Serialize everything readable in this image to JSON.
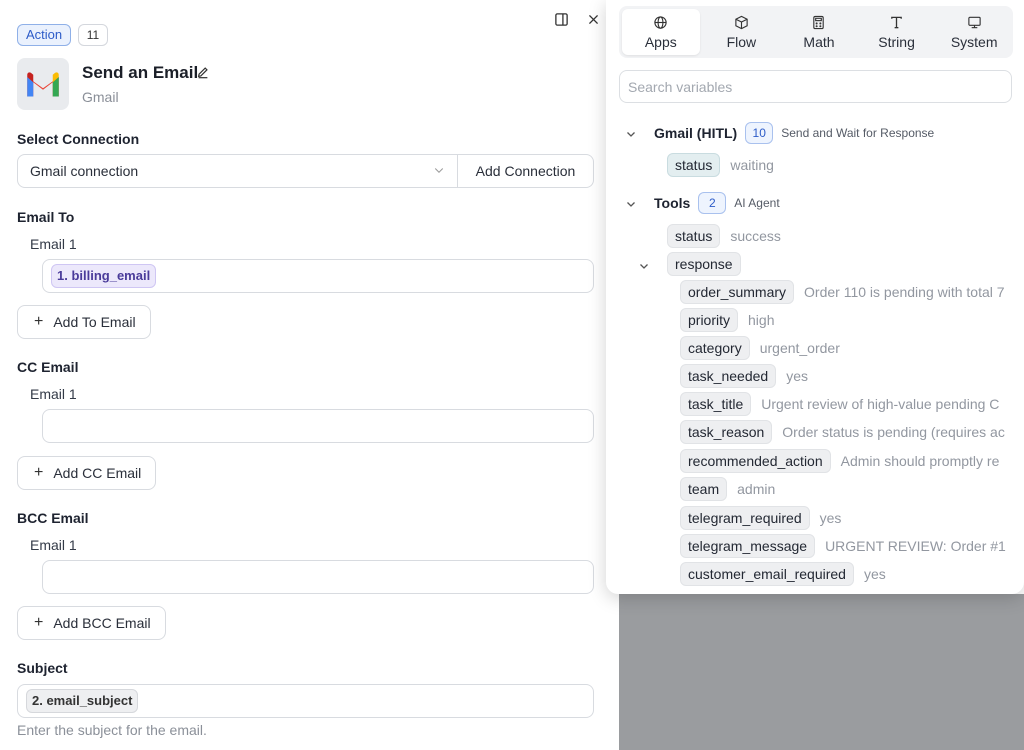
{
  "header": {
    "badge": "Action",
    "count": "11",
    "title": "Send an Email",
    "subtitle": "Gmail"
  },
  "connection": {
    "label": "Select Connection",
    "value": "Gmail connection",
    "add_label": "Add Connection"
  },
  "email_to": {
    "label": "Email To",
    "sub": "Email 1",
    "chip": "1. billing_email",
    "add_label": "Add To Email"
  },
  "cc": {
    "label": "CC Email",
    "sub": "Email 1",
    "add_label": "Add CC Email"
  },
  "bcc": {
    "label": "BCC Email",
    "sub": "Email 1",
    "add_label": "Add BCC Email"
  },
  "subject": {
    "label": "Subject",
    "chip": "2. email_subject",
    "hint": "Enter the subject for the email."
  },
  "popover": {
    "tabs": [
      {
        "label": "Apps",
        "icon": "globe-icon"
      },
      {
        "label": "Flow",
        "icon": "cube-icon"
      },
      {
        "label": "Math",
        "icon": "calculator-icon"
      },
      {
        "label": "String",
        "icon": "text-icon"
      },
      {
        "label": "System",
        "icon": "monitor-icon"
      }
    ],
    "search_placeholder": "Search variables",
    "groups": [
      {
        "name": "Gmail (HITL)",
        "count": "10",
        "desc": "Send and Wait for Response",
        "items": [
          {
            "key": "status",
            "value": "waiting"
          }
        ]
      },
      {
        "name": "Tools",
        "count": "2",
        "desc": "AI Agent",
        "items": [
          {
            "key": "status",
            "value": "success"
          },
          {
            "key": "response",
            "value": ""
          }
        ],
        "response_items": [
          {
            "key": "order_summary",
            "value": "Order 110 is pending with total 7"
          },
          {
            "key": "priority",
            "value": "high"
          },
          {
            "key": "category",
            "value": "urgent_order"
          },
          {
            "key": "task_needed",
            "value": "yes"
          },
          {
            "key": "task_title",
            "value": "Urgent review of high-value pending C"
          },
          {
            "key": "task_reason",
            "value": "Order status is pending (requires ac"
          },
          {
            "key": "recommended_action",
            "value": "Admin should promptly re"
          },
          {
            "key": "team",
            "value": "admin"
          },
          {
            "key": "telegram_required",
            "value": "yes"
          },
          {
            "key": "telegram_message",
            "value": "URGENT REVIEW: Order #1"
          },
          {
            "key": "customer_email_required",
            "value": "yes"
          }
        ]
      }
    ]
  }
}
